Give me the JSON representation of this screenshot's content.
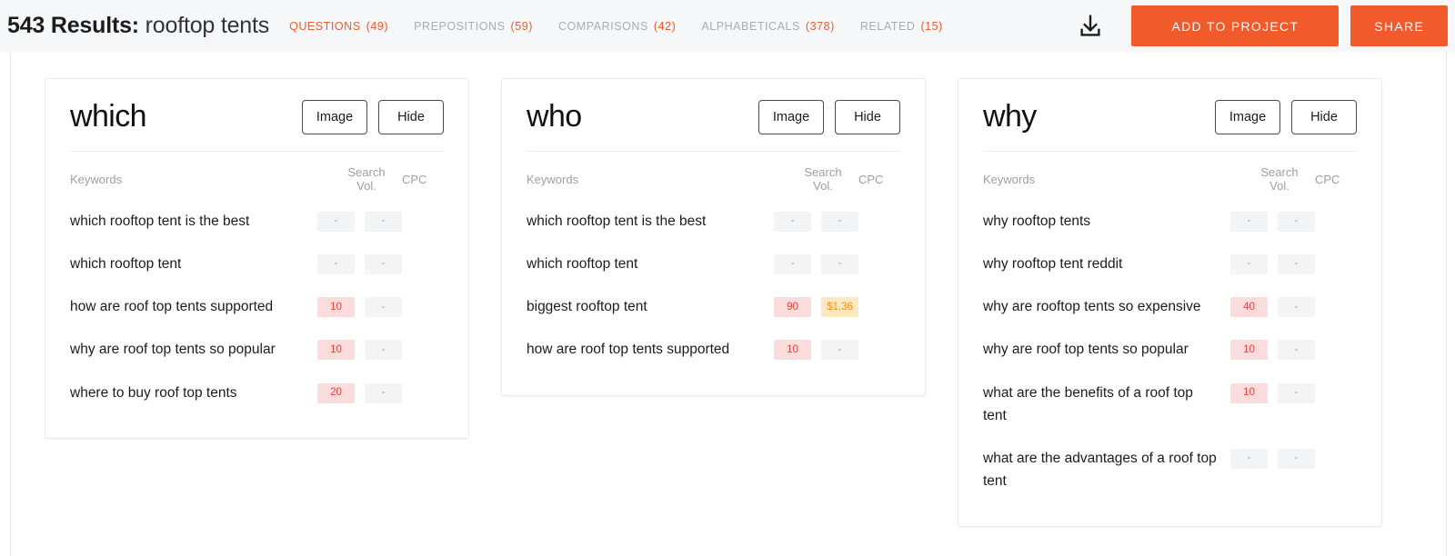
{
  "header": {
    "results_count": "543",
    "results_label": "Results:",
    "search_term": "rooftop tents",
    "tabs": [
      {
        "label": "QUESTIONS",
        "count": "(49)",
        "active": true,
        "name": "tab-questions"
      },
      {
        "label": "PREPOSITIONS",
        "count": "(59)",
        "active": false,
        "name": "tab-prepositions"
      },
      {
        "label": "COMPARISONS",
        "count": "(42)",
        "active": false,
        "name": "tab-comparisons"
      },
      {
        "label": "ALPHABETICALS",
        "count": "(378)",
        "active": false,
        "name": "tab-alphabeticals"
      },
      {
        "label": "RELATED",
        "count": "(15)",
        "active": false,
        "name": "tab-related"
      }
    ],
    "download_icon": "download-icon",
    "add_to_project_label": "ADD TO PROJECT",
    "share_label": "SHARE",
    "accent_color": "#f15a2b",
    "background_color": "#f6f7f9"
  },
  "table_headers": {
    "keywords": "Keywords",
    "search_volume": "Search Vol.",
    "cpc": "CPC"
  },
  "buttons": {
    "image": "Image",
    "hide": "Hide"
  },
  "badge_colors": {
    "empty_bg": "#f3f4f5",
    "empty_text": "#9aa0a6",
    "volume_bg": "#fbdcdc",
    "volume_text": "#e8453c",
    "cpc_bg": "#fde8bf",
    "cpc_text": "#f0952b"
  },
  "cards": [
    {
      "title": "which",
      "rows": [
        {
          "keyword": "which rooftop tent is the best",
          "volume": "-",
          "cpc": "-",
          "volume_type": "empty",
          "cpc_type": "empty"
        },
        {
          "keyword": "which rooftop tent",
          "volume": "-",
          "cpc": "-",
          "volume_type": "empty",
          "cpc_type": "empty"
        },
        {
          "keyword": "how are roof top tents supported",
          "volume": "10",
          "cpc": "-",
          "volume_type": "vol",
          "cpc_type": "empty"
        },
        {
          "keyword": "why are roof top tents so popular",
          "volume": "10",
          "cpc": "-",
          "volume_type": "vol",
          "cpc_type": "empty"
        },
        {
          "keyword": "where to buy roof top tents",
          "volume": "20",
          "cpc": "-",
          "volume_type": "vol",
          "cpc_type": "empty"
        }
      ]
    },
    {
      "title": "who",
      "rows": [
        {
          "keyword": "which rooftop tent is the best",
          "volume": "-",
          "cpc": "-",
          "volume_type": "empty",
          "cpc_type": "empty"
        },
        {
          "keyword": "which rooftop tent",
          "volume": "-",
          "cpc": "-",
          "volume_type": "empty",
          "cpc_type": "empty"
        },
        {
          "keyword": "biggest rooftop tent",
          "volume": "90",
          "cpc": "$1.36",
          "volume_type": "vol",
          "cpc_type": "cpc"
        },
        {
          "keyword": "how are roof top tents supported",
          "volume": "10",
          "cpc": "-",
          "volume_type": "vol",
          "cpc_type": "empty"
        }
      ]
    },
    {
      "title": "why",
      "rows": [
        {
          "keyword": "why rooftop tents",
          "volume": "-",
          "cpc": "-",
          "volume_type": "empty",
          "cpc_type": "empty"
        },
        {
          "keyword": "why rooftop tent reddit",
          "volume": "-",
          "cpc": "-",
          "volume_type": "empty",
          "cpc_type": "empty"
        },
        {
          "keyword": "why are rooftop tents so expensive",
          "volume": "40",
          "cpc": "-",
          "volume_type": "vol",
          "cpc_type": "empty"
        },
        {
          "keyword": "why are roof top tents so popular",
          "volume": "10",
          "cpc": "-",
          "volume_type": "vol",
          "cpc_type": "empty"
        },
        {
          "keyword": "what are the benefits of a roof top tent",
          "volume": "10",
          "cpc": "-",
          "volume_type": "vol",
          "cpc_type": "empty"
        },
        {
          "keyword": "what are the advantages of a roof top tent",
          "volume": "-",
          "cpc": "-",
          "volume_type": "empty",
          "cpc_type": "empty"
        }
      ]
    }
  ]
}
